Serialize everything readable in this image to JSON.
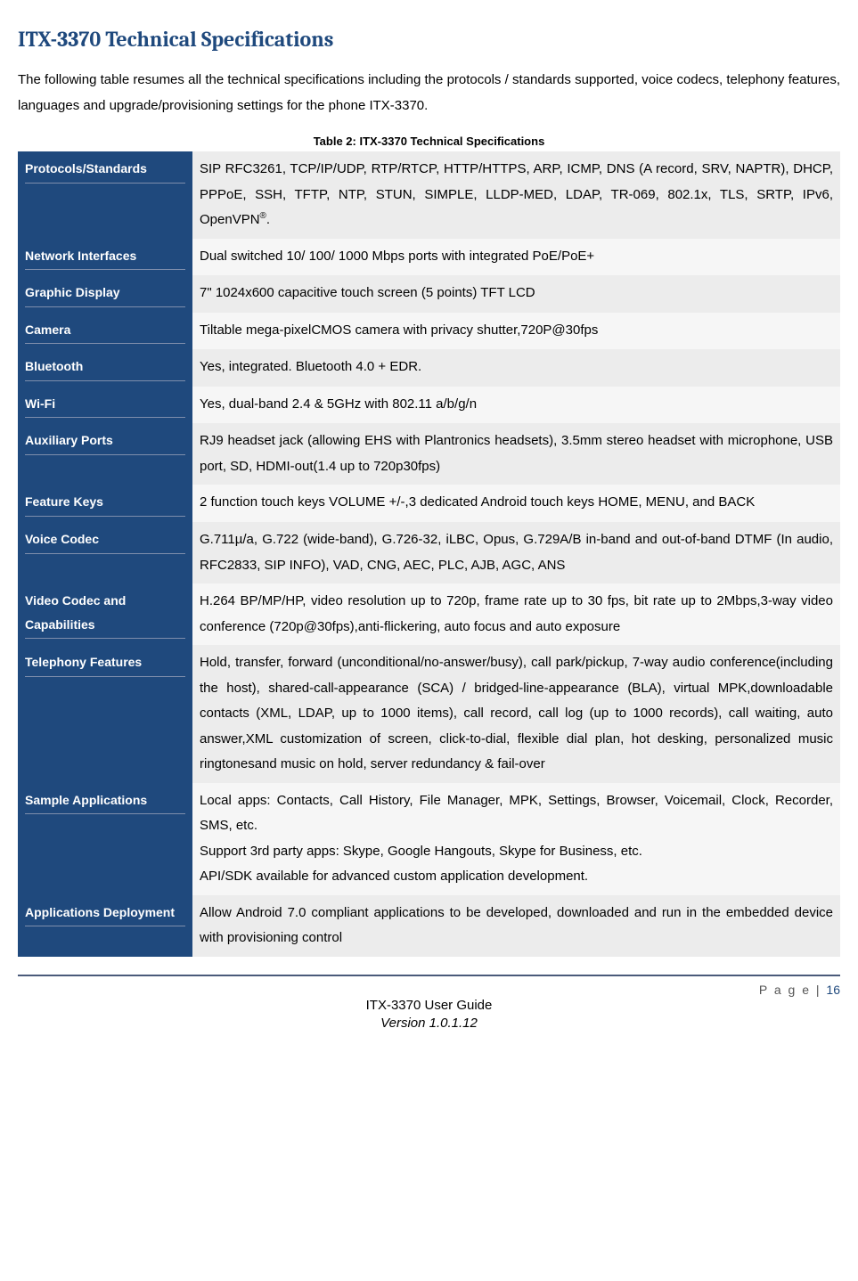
{
  "title": "ITX-3370 Technical Specifications",
  "intro": "The following table resumes all the technical specifications including the protocols / standards supported, voice codecs, telephony features, languages and upgrade/provisioning settings for the phone ITX-3370.",
  "table_caption": "Table 2: ITX-3370 Technical Specifications",
  "rows": [
    {
      "label": "Protocols/Standards",
      "value": "SIP RFC3261, TCP/IP/UDP, RTP/RTCP, HTTP/HTTPS, ARP, ICMP, DNS (A record, SRV, NAPTR), DHCP, PPPoE, SSH, TFTP, NTP, STUN, SIMPLE, LLDP-MED, LDAP, TR-069, 802.1x, TLS, SRTP, IPv6, OpenVPN®."
    },
    {
      "label": "Network Interfaces",
      "value": "Dual switched 10/ 100/ 1000 Mbps ports with integrated PoE/PoE+"
    },
    {
      "label": "Graphic Display",
      "value": "7\" 1024x600 capacitive touch screen (5 points) TFT LCD"
    },
    {
      "label": "Camera",
      "value": "Tiltable mega-pixelCMOS camera with privacy shutter,720P@30fps"
    },
    {
      "label": "Bluetooth",
      "value": "Yes, integrated. Bluetooth 4.0 + EDR."
    },
    {
      "label": "Wi-Fi",
      "value": "Yes, dual-band 2.4 & 5GHz with 802.11 a/b/g/n"
    },
    {
      "label": "Auxiliary Ports",
      "value": "RJ9 headset jack (allowing EHS with Plantronics headsets), 3.5mm stereo headset with microphone, USB port, SD, HDMI-out(1.4 up to 720p30fps)"
    },
    {
      "label": "Feature Keys",
      "value": "2 function touch keys VOLUME +/-,3 dedicated Android touch keys HOME, MENU, and BACK"
    },
    {
      "label": "Voice Codec",
      "value": "G.711µ/a, G.722 (wide-band), G.726-32, iLBC, Opus, G.729A/B in-band and out-of-band DTMF (In audio, RFC2833, SIP INFO), VAD, CNG, AEC, PLC, AJB, AGC, ANS"
    },
    {
      "label": "Video Codec and Capabilities",
      "value": "H.264 BP/MP/HP, video resolution up to 720p, frame rate up to 30 fps, bit rate up to 2Mbps,3-way video conference (720p@30fps),anti-flickering, auto focus and auto exposure"
    },
    {
      "label": "Telephony Features",
      "value": "Hold, transfer, forward (unconditional/no-answer/busy), call park/pickup,  7-way audio conference(including the host), shared-call-appearance (SCA) / bridged-line-appearance (BLA),  virtual MPK,downloadable contacts (XML, LDAP, up to 1000 items), call record, call log (up to 1000 records), call waiting, auto answer,XML customization of screen, click-to-dial, flexible dial plan, hot desking, personalized music ringtonesand music on hold, server redundancy & fail-over"
    },
    {
      "label": "Sample Applications",
      "value": "Local apps: Contacts, Call History, File Manager, MPK, Settings, Browser, Voicemail, Clock, Recorder, SMS, etc.\nSupport 3rd party apps: Skype, Google Hangouts, Skype for Business, etc.\nAPI/SDK available for advanced custom application development."
    },
    {
      "label": "Applications Deployment",
      "value": "Allow Android 7.0 compliant applications to be developed, downloaded and run in the embedded device with provisioning control"
    }
  ],
  "footer": {
    "page_label": "P a g e | ",
    "page_num": "16",
    "guide": "ITX-3370 User Guide",
    "version": "Version 1.0.1.12"
  }
}
